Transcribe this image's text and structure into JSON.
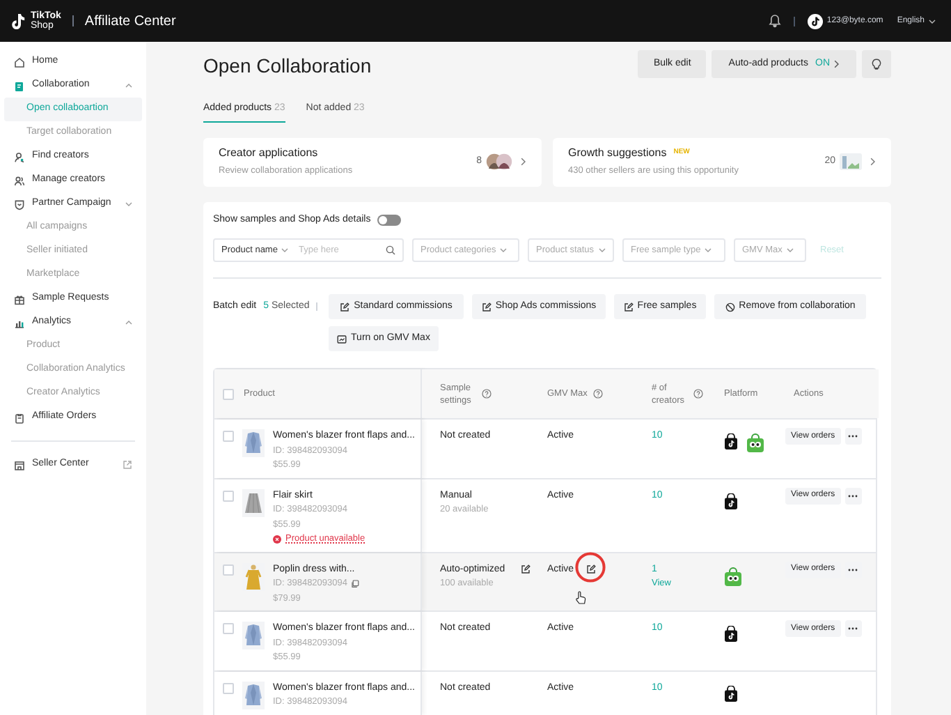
{
  "top_bar": {
    "logo": {
      "line1": "TikTok",
      "line2": "Shop"
    },
    "title": "Affiliate Center",
    "account": "123@byte.com",
    "language": "English"
  },
  "sidebar": {
    "items": [
      {
        "label": "Home",
        "selected": false
      },
      {
        "label": "Collaboration",
        "selected": false,
        "expanded": true,
        "children": [
          {
            "label": "Open collaboartion",
            "selected": true
          },
          {
            "label": "Target collaboration",
            "selected": false
          }
        ]
      },
      {
        "label": "Find creators",
        "selected": false
      },
      {
        "label": "Manage creators",
        "selected": false
      },
      {
        "label": "Partner Campaign",
        "selected": false,
        "expanded": false,
        "children": [
          {
            "label": "All campaigns",
            "selected": false
          },
          {
            "label": "Seller initiated",
            "selected": false
          },
          {
            "label": "Marketplace",
            "selected": false
          }
        ]
      },
      {
        "label": "Sample Requests",
        "selected": false
      },
      {
        "label": "Analytics",
        "selected": false,
        "expanded": true,
        "children": [
          {
            "label": "Product",
            "selected": false
          },
          {
            "label": "Collaboration Analytics",
            "selected": false
          },
          {
            "label": "Creator Analytics",
            "selected": false
          }
        ]
      },
      {
        "label": "Affiliate Orders",
        "selected": false
      }
    ],
    "footer": {
      "label": "Seller Center"
    }
  },
  "header": {
    "title": "Open Collaboration",
    "buttons": [
      {
        "label": "Bulk edit"
      },
      {
        "label": "Auto-add products",
        "status": "ON"
      }
    ]
  },
  "tabs": [
    {
      "label": "Added products",
      "count": "23",
      "selected": true
    },
    {
      "label": "Not added",
      "count": "23",
      "selected": false
    }
  ],
  "cards": [
    {
      "title": "Creator applications",
      "subtitle": "Review collaboration applications",
      "count": "8"
    },
    {
      "title": "Growth suggestions",
      "badge": "NEW",
      "subtitle": "430 other sellers are using this opportunity",
      "count": "20"
    }
  ],
  "details_toggle": {
    "label": "Show samples and Shop Ads details",
    "on": false
  },
  "filters": {
    "search": {
      "field": "Product name",
      "placeholder": "Type here"
    },
    "dropdowns": [
      "Product categories",
      "Product status",
      "Free sample type",
      "GMV Max"
    ],
    "reset": {
      "label": "Reset",
      "disabled": true
    }
  },
  "batch_edit": {
    "label": "Batch edit",
    "count": "5",
    "count_label": "Selected",
    "actions": [
      "Standard commissions",
      "Shop Ads commissions",
      "Free samples",
      "Remove from collaboration",
      "Turn on GMV Max"
    ]
  },
  "table": {
    "select_all_checked": false,
    "columns": [
      {
        "label": "Product",
        "help": false
      },
      {
        "label": "Sample settings",
        "help": true
      },
      {
        "label": "GMV Max",
        "help": true
      },
      {
        "label": "# of creators",
        "help": true
      },
      {
        "label": "Platform",
        "help": false
      },
      {
        "label": "Actions",
        "help": false
      }
    ],
    "rows": [
      {
        "checked": false,
        "hovered": false,
        "name": "Women's blazer front flaps and...",
        "id": "ID: 398482093094",
        "price": "$55.99",
        "sample": "Not created",
        "gmv": "Active",
        "creators": "10",
        "platforms": [
          {
            "kind": "tiktok"
          },
          {
            "kind": "tokopedia"
          }
        ],
        "action": "View orders"
      },
      {
        "checked": false,
        "hovered": false,
        "name": "Flair skirt",
        "id": "ID: 398482093094",
        "price": "$55.99",
        "warning": "Product unavailable",
        "sample": "Manual",
        "sample_note": "20 available",
        "gmv": "Active",
        "creators": "10",
        "platforms": [
          {
            "kind": "tiktok"
          }
        ],
        "action": "View orders"
      },
      {
        "checked": false,
        "hovered": true,
        "name": "Poplin dress with...",
        "id": "ID: 398482093094",
        "price": "$79.99",
        "sample": "Auto-optimized",
        "sample_note": "100 available",
        "gmv": "Active",
        "creators": "1",
        "creators_link": "View",
        "platforms": [
          {
            "kind": "tokopedia"
          }
        ],
        "action": "View orders"
      },
      {
        "checked": false,
        "hovered": false,
        "name": "Women's blazer front flaps and...",
        "id": "ID: 398482093094",
        "price": "$55.99",
        "sample": "Not created",
        "gmv": "Active",
        "creators": "10",
        "platforms": [
          {
            "kind": "tiktok"
          }
        ],
        "action": "View orders"
      },
      {
        "checked": false,
        "hovered": false,
        "name": "Women's blazer front flaps and...",
        "id": "ID: 398482093094",
        "sample": "Not created",
        "gmv": "Active",
        "creators": "10",
        "platforms": [
          {
            "kind": "tiktok"
          }
        ]
      }
    ]
  }
}
